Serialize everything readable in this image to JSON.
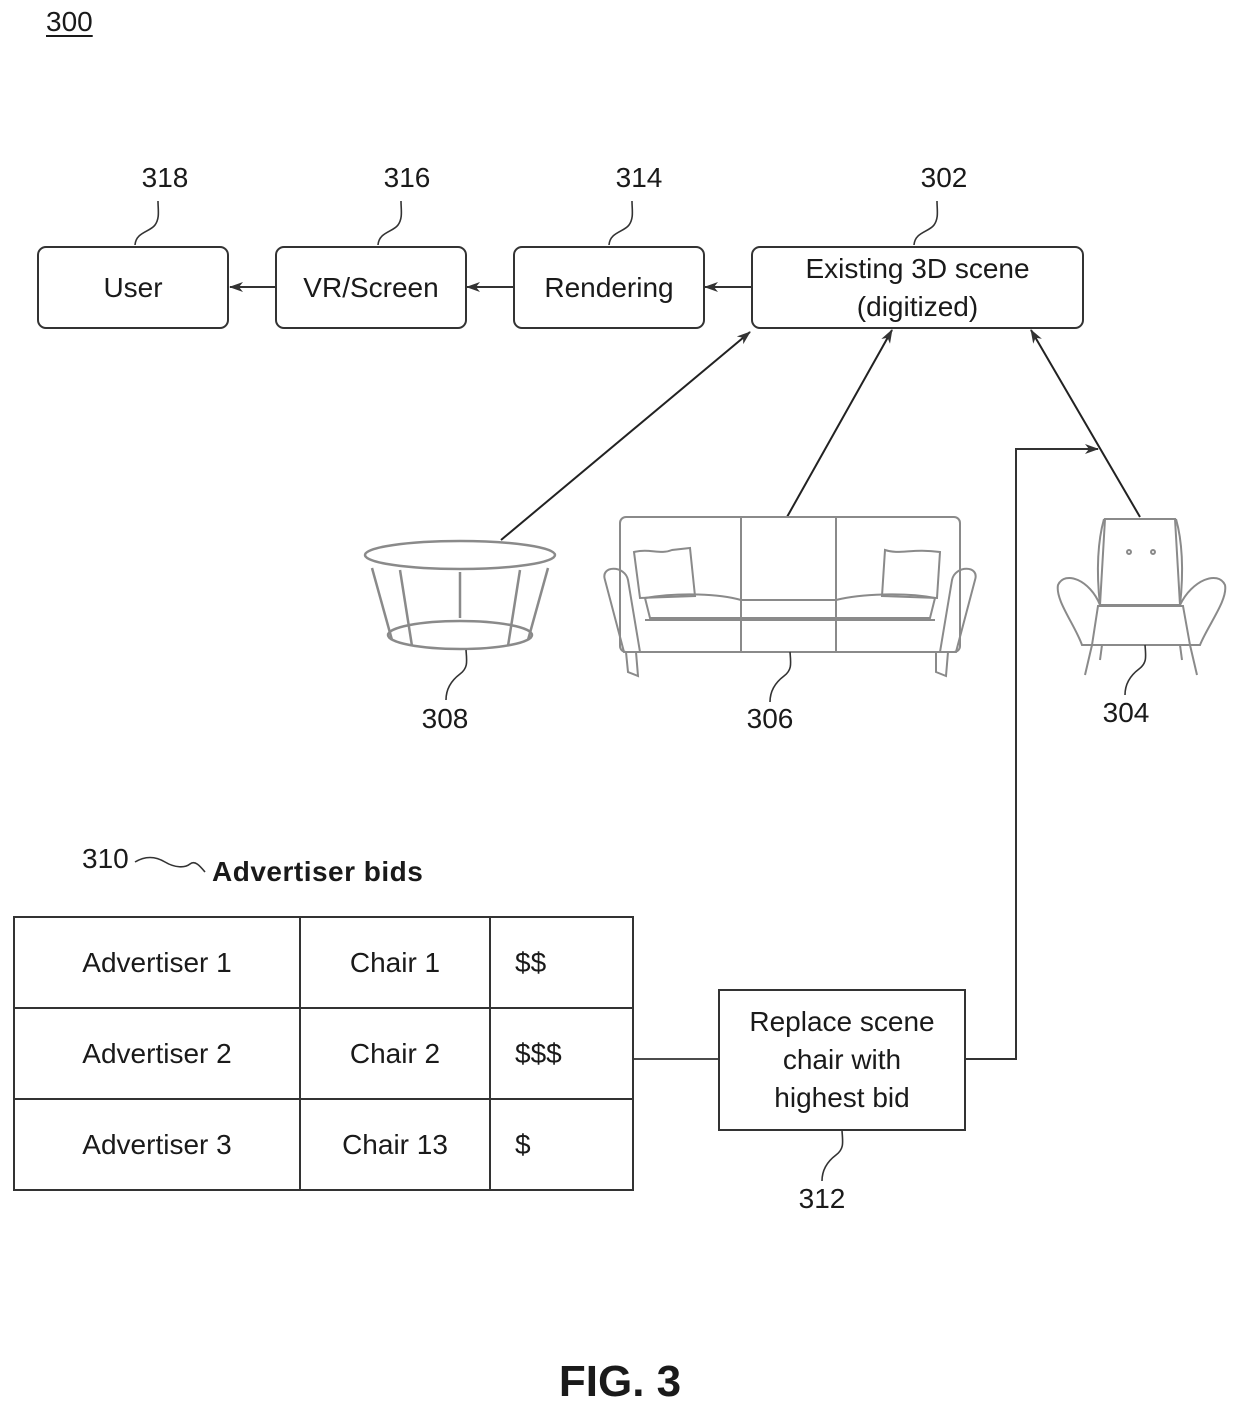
{
  "figure_number": "300",
  "figure_title": "FIG. 3",
  "pipeline": {
    "user": {
      "label": "User",
      "ref": "318"
    },
    "screen": {
      "label": "VR/Screen",
      "ref": "316"
    },
    "rendering": {
      "label": "Rendering",
      "ref": "314"
    },
    "scene": {
      "label_line1": "Existing 3D scene",
      "label_line2": "(digitized)",
      "ref": "302"
    }
  },
  "objects": {
    "table": {
      "ref": "308",
      "icon": "coffee-table-icon"
    },
    "sofa": {
      "ref": "306",
      "icon": "sofa-icon"
    },
    "chair": {
      "ref": "304",
      "icon": "armchair-icon"
    }
  },
  "bids": {
    "ref": "310",
    "title": "Advertiser bids",
    "rows": [
      {
        "advertiser": "Advertiser 1",
        "item": "Chair 1",
        "bid": "$$"
      },
      {
        "advertiser": "Advertiser 2",
        "item": "Chair 2",
        "bid": "$$$"
      },
      {
        "advertiser": "Advertiser 3",
        "item": "Chair 13",
        "bid": "$"
      }
    ]
  },
  "replace_step": {
    "label_line1": "Replace scene",
    "label_line2": "chair with",
    "label_line3": "highest bid",
    "ref": "312"
  }
}
